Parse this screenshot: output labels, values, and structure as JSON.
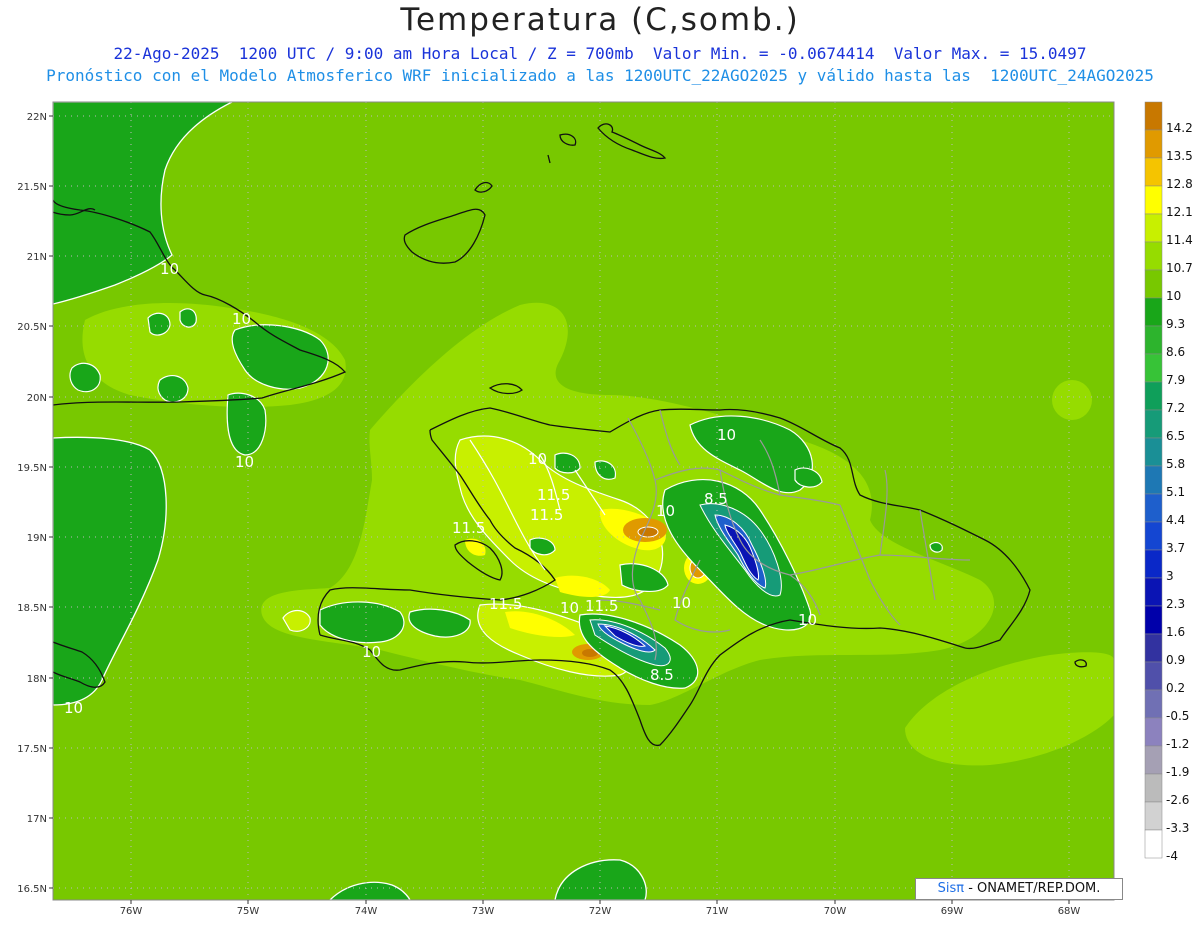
{
  "header": {
    "title": "Temperatura (C,somb.)",
    "line1": "22-Ago-2025  1200 UTC / 9:00 am Hora Local / Z = 700mb  Valor Min. = -0.0674414  Valor Max. = 15.0497",
    "line2": "Pronóstico con el Modelo Atmosferico WRF inicializado a las 1200UTC_22AGO2025 y válido hasta las  1200UTC_24AGO2025"
  },
  "axes": {
    "lat_labels": [
      "22N",
      "21.5N",
      "21N",
      "20.5N",
      "20N",
      "19.5N",
      "19N",
      "18.5N",
      "18N",
      "17.5N",
      "17N",
      "16.5N"
    ],
    "lon_labels": [
      "76W",
      "75W",
      "74W",
      "73W",
      "72W",
      "71W",
      "70W",
      "69W",
      "68W"
    ]
  },
  "colorbar": {
    "labels": [
      "14.2",
      "13.5",
      "12.8",
      "12.1",
      "11.4",
      "10.7",
      "10",
      "9.3",
      "8.6",
      "7.9",
      "7.2",
      "6.5",
      "5.8",
      "5.1",
      "4.4",
      "3.7",
      "3",
      "2.3",
      "1.6",
      "0.9",
      "0.2",
      "-0.5",
      "-1.2",
      "-1.9",
      "-2.6",
      "-3.3",
      "-4"
    ],
    "colors": [
      "#c87800",
      "#e09a00",
      "#f5c400",
      "#ffff00",
      "#c8f000",
      "#96dc00",
      "#78c800",
      "#19a619",
      "#2db42d",
      "#37c337",
      "#0f9f5a",
      "#169b78",
      "#1a8f96",
      "#1e78b4",
      "#1e5fcc",
      "#1446d2",
      "#0a28c8",
      "#0a14b4",
      "#0000aa",
      "#3232a0",
      "#5050aa",
      "#7070b4",
      "#8c82be",
      "#a5a0b4",
      "#bbbbbb",
      "#d2d2d2",
      "#ffffff"
    ]
  },
  "contour_labels": [
    "10",
    "10",
    "10",
    "10",
    "11.5",
    "11.5",
    "11.5",
    "11.5",
    "10",
    "8.5",
    "10",
    "10",
    "10",
    "10",
    "11.5",
    "10",
    "10",
    "8.5",
    "10"
  ],
  "credit": {
    "sis": "Sisπ",
    "rest": " - ONAMET/REP.DOM."
  },
  "colors": {
    "background_field": "#78c800",
    "darker_field": "#19a619",
    "light_field": "#96dc00"
  }
}
